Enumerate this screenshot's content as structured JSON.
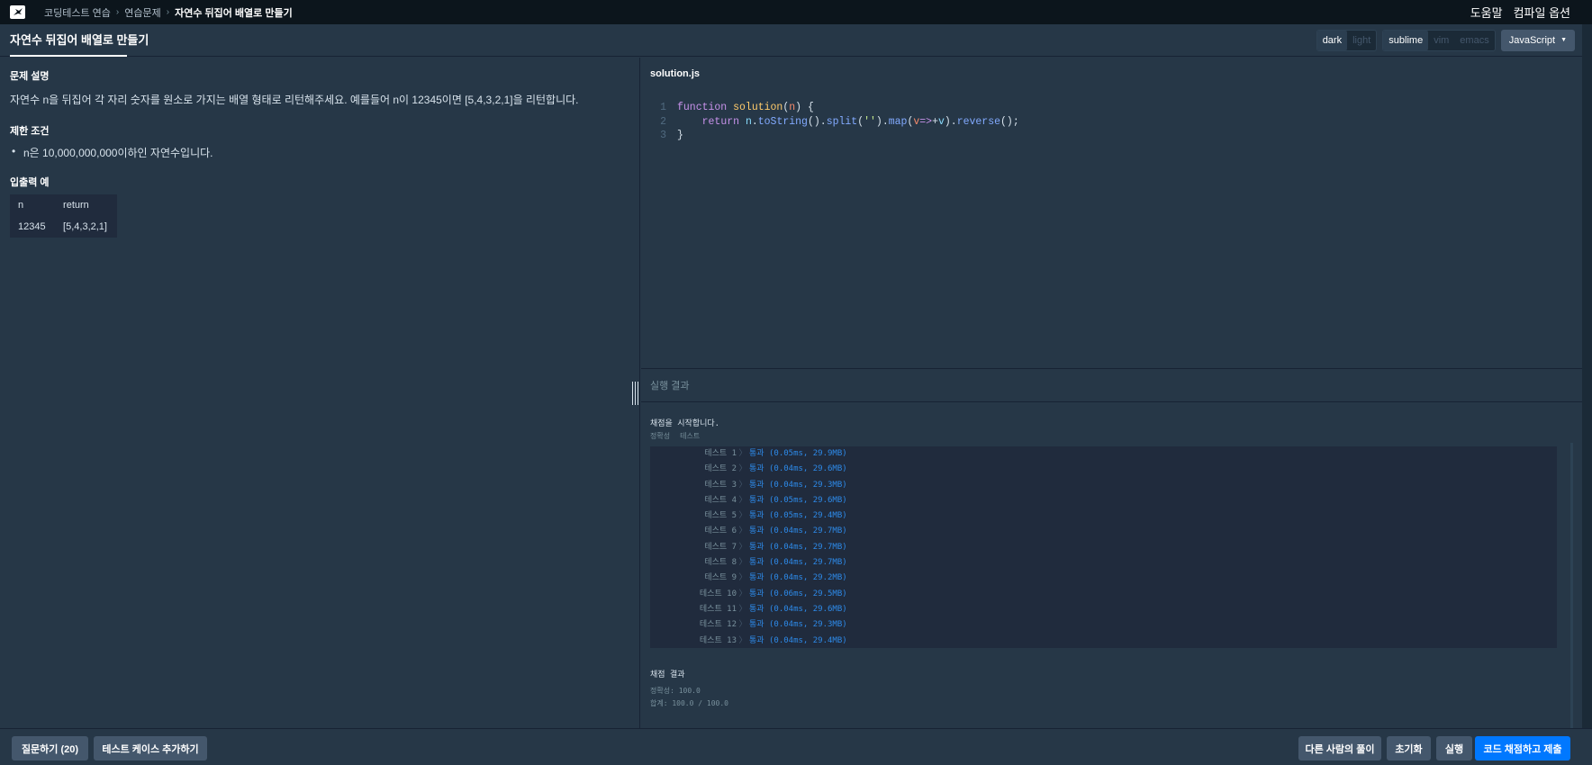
{
  "topnav": {
    "breadcrumbs": [
      "코딩테스트 연습",
      "연습문제",
      "자연수 뒤집어 배열로 만들기"
    ],
    "help": "도움말",
    "compile_options": "컴파일 옵션"
  },
  "tabbar": {
    "title": "자연수 뒤집어 배열로 만들기",
    "themes": [
      "dark",
      "light"
    ],
    "keymaps": [
      "sublime",
      "vim",
      "emacs"
    ],
    "language": "JavaScript"
  },
  "problem": {
    "desc_title": "문제 설명",
    "description": "자연수 n을 뒤집어 각 자리 숫자를 원소로 가지는 배열 형태로 리턴해주세요. 예를들어 n이 12345이면 [5,4,3,2,1]을 리턴합니다.",
    "constraint_title": "제한 조건",
    "constraint": "n은 10,000,000,000이하인 자연수입니다.",
    "io_title": "입출력 예",
    "io_headers": [
      "n",
      "return"
    ],
    "io_row": [
      "12345",
      "[5,4,3,2,1]"
    ]
  },
  "editor": {
    "filename": "solution.js",
    "line_numbers": [
      "1",
      "2",
      "3"
    ]
  },
  "results": {
    "title": "실행 결과",
    "start": "채점을 시작합니다.",
    "head_accuracy": "정확성",
    "head_test": "테스트",
    "tests": [
      {
        "name": "테스트 1",
        "result": "통과 (0.05ms, 29.9MB)"
      },
      {
        "name": "테스트 2",
        "result": "통과 (0.04ms, 29.6MB)"
      },
      {
        "name": "테스트 3",
        "result": "통과 (0.04ms, 29.3MB)"
      },
      {
        "name": "테스트 4",
        "result": "통과 (0.05ms, 29.6MB)"
      },
      {
        "name": "테스트 5",
        "result": "통과 (0.05ms, 29.4MB)"
      },
      {
        "name": "테스트 6",
        "result": "통과 (0.04ms, 29.7MB)"
      },
      {
        "name": "테스트 7",
        "result": "통과 (0.04ms, 29.7MB)"
      },
      {
        "name": "테스트 8",
        "result": "통과 (0.04ms, 29.7MB)"
      },
      {
        "name": "테스트 9",
        "result": "통과 (0.04ms, 29.2MB)"
      },
      {
        "name": "테스트 10",
        "result": "통과 (0.06ms, 29.5MB)"
      },
      {
        "name": "테스트 11",
        "result": "통과 (0.04ms, 29.6MB)"
      },
      {
        "name": "테스트 12",
        "result": "통과 (0.04ms, 29.3MB)"
      },
      {
        "name": "테스트 13",
        "result": "통과 (0.04ms, 29.4MB)"
      }
    ],
    "summary_title": "채점 결과",
    "accuracy": "정확성: 100.0",
    "total": "합계: 100.0 / 100.0"
  },
  "bottombar": {
    "question": "질문하기 (20)",
    "add_testcase": "테스트 케이스 추가하기",
    "others_solutions": "다른 사람의 풀이",
    "reset": "초기화",
    "run": "실행",
    "submit": "코드 채점하고 제출"
  },
  "colors": {
    "accent": "#0078ff",
    "pass": "#2d8ae9",
    "background": "#263747",
    "nav": "#0c151c"
  }
}
